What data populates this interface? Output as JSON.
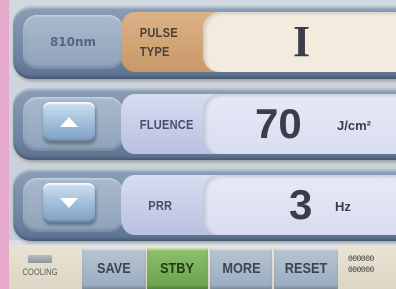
{
  "panel": {
    "wavelength": "810nm",
    "pulse_type": {
      "label_line1": "PULSE",
      "label_line2": "TYPE",
      "value": "I"
    },
    "fluence": {
      "label": "FLUENCE",
      "value": "70",
      "unit": "J/cm²",
      "increase_icon": "arrow-up-icon"
    },
    "prr": {
      "label": "PRR",
      "value": "3",
      "unit": "Hz",
      "decrease_icon": "arrow-down-icon"
    }
  },
  "bottom": {
    "cooling_label": "COOLING",
    "buttons": {
      "save": "SAVE",
      "stby": "STBY",
      "more": "MORE",
      "reset": "RESET"
    },
    "counter_line1": "000000",
    "counter_line2": "000000"
  },
  "colors": {
    "accent_pulse": "#d3a577",
    "stby_green": "#7bb15c",
    "row_blue": "#7a8fab",
    "button_gray": "#a9b7c9"
  }
}
